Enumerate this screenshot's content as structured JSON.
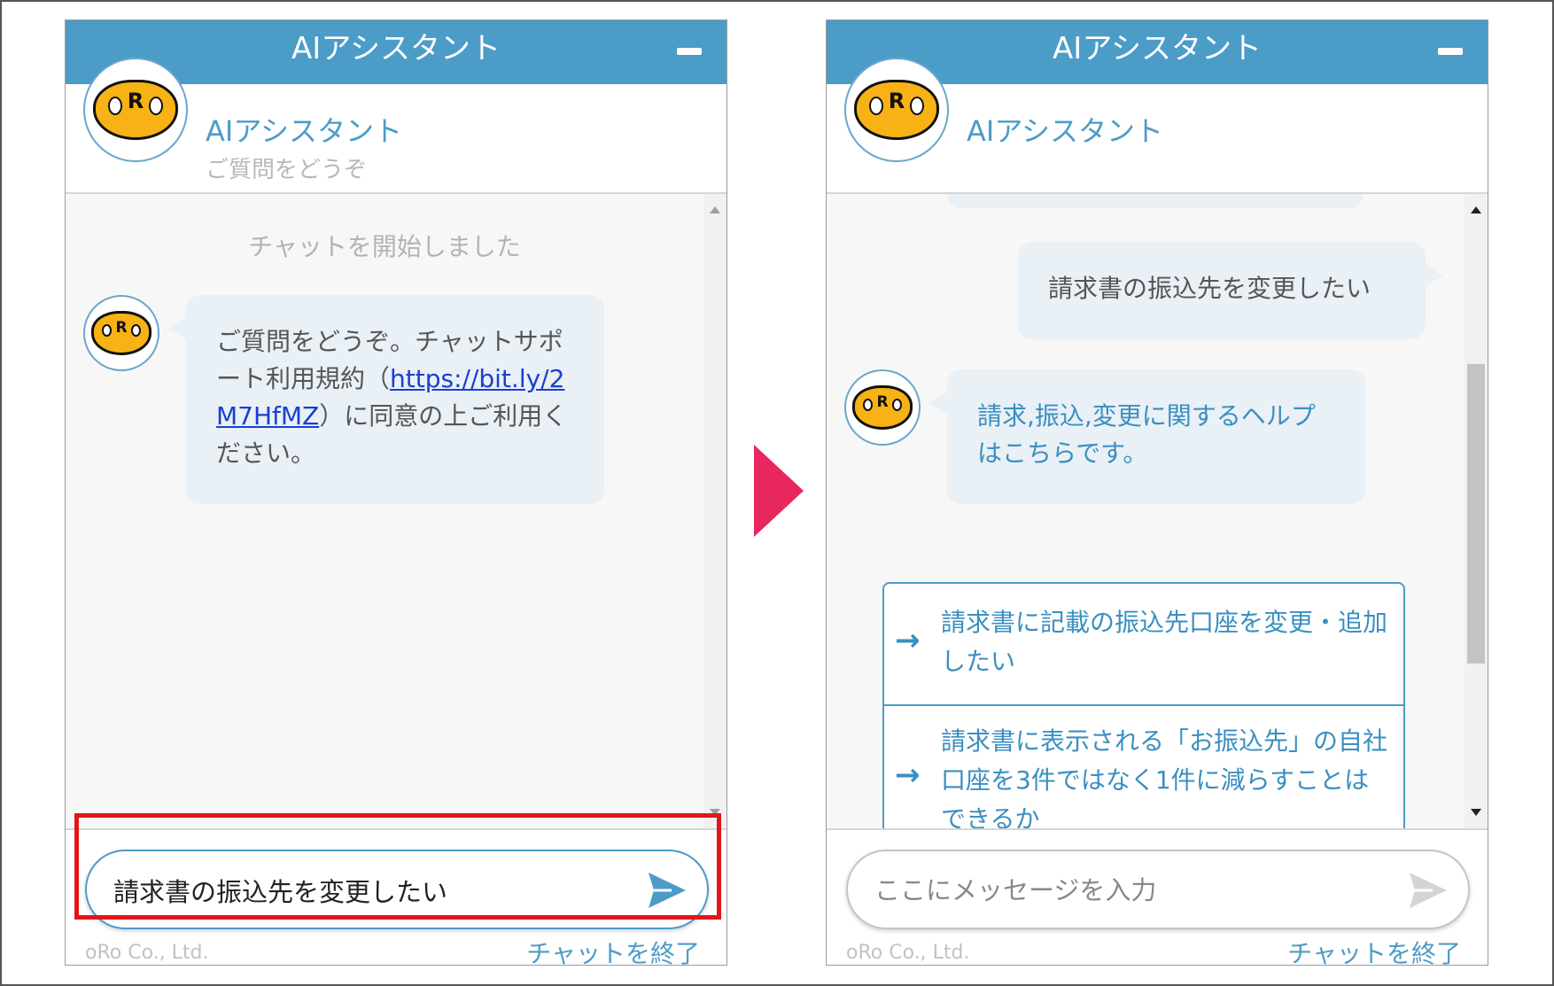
{
  "colors": {
    "titlebar": "#4c9cc8",
    "highlight": "#e3141b",
    "flow_arrow": "#e8275f",
    "bubble": "#e9f0f6",
    "link": "#1a3fd0",
    "option_text": "#3a8fc1"
  },
  "icons": [
    "minimize-icon",
    "bot-avatar-icon",
    "send-icon",
    "option-arrow-icon",
    "flow-arrow-icon"
  ],
  "left": {
    "window_title": "AIアシスタント",
    "bot_name": "AIアシスタント",
    "bot_subtitle": "ご質問をどうぞ",
    "avatar_mouth": "R",
    "system_message": "チャットを開始しました",
    "bot_message": {
      "before_link": "ご質問をどうぞ。チャットサポート利用規約（",
      "link": "https://bit.ly/2M7HfMZ",
      "after_link": "）に同意の上ご利用ください。"
    },
    "input_value": "請求書の振込先を変更したい",
    "footer_brand": "oRo Co., Ltd.",
    "end_chat_label": "チャットを終了"
  },
  "right": {
    "window_title": "AIアシスタント",
    "bot_name": "AIアシスタント",
    "avatar_mouth": "R",
    "user_message": "請求書の振込先を変更したい",
    "bot_message": "請求,振込,変更に関するヘルプはこちらです。",
    "options": [
      {
        "label": "請求書に記載の振込先口座を変更・追加したい"
      },
      {
        "label": "請求書に表示される「お振込先」の自社口座を3件ではなく1件に減らすことはできるか"
      }
    ],
    "input_placeholder": "ここにメッセージを入力",
    "footer_brand": "oRo Co., Ltd.",
    "end_chat_label": "チャットを終了"
  }
}
